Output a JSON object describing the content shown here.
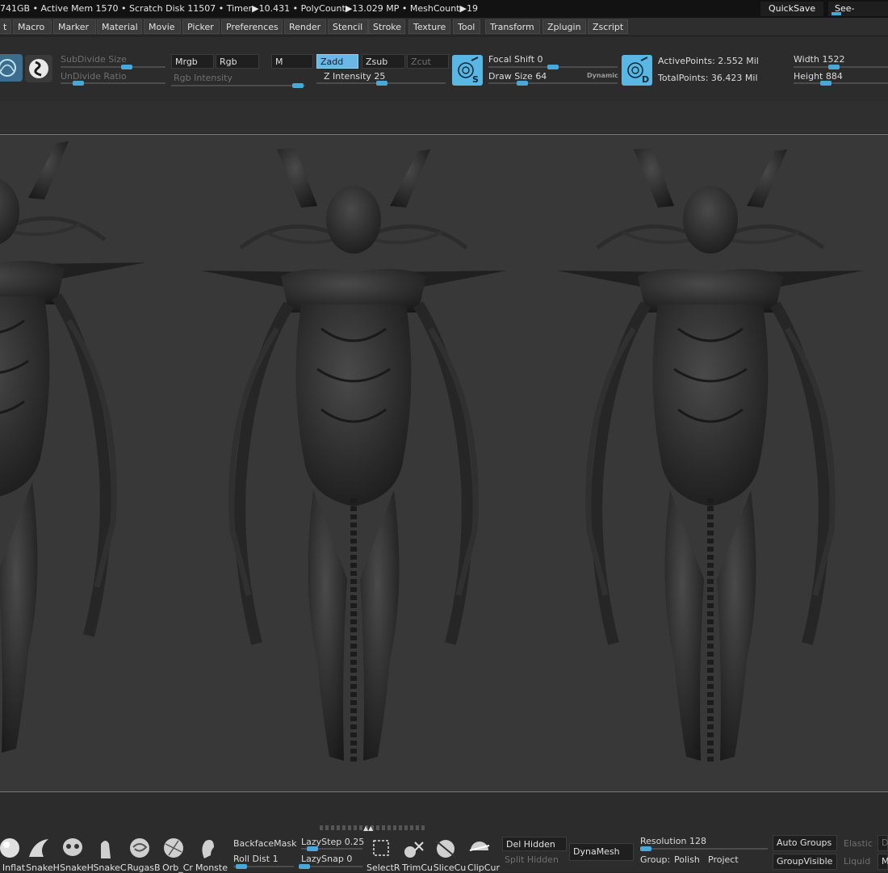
{
  "status": {
    "text": "741GB • Active Mem 1570 • Scratch Disk 11507 • Timer▶10.431 • PolyCount▶13.029 MP • MeshCount▶19",
    "quicksave": "QuickSave",
    "seethrough": "See-through"
  },
  "menu": [
    "t",
    "Macro",
    "Marker",
    "Material",
    "Movie",
    "Picker",
    "Preferences",
    "Render",
    "Stencil",
    "Stroke",
    "Texture",
    "Tool",
    "Transform",
    "Zplugin",
    "Zscript"
  ],
  "shelf": {
    "subdivide_size": "SubDivide Size",
    "undivide_ratio": "UnDivide Ratio",
    "mrgb": "Mrgb",
    "rgb": "Rgb",
    "m": "M",
    "rgb_intensity": "Rgb Intensity",
    "zadd": "Zadd",
    "zsub": "Zsub",
    "zcut": "Zcut",
    "z_intensity": "Z Intensity",
    "z_intensity_value": "25",
    "focal_shift": "Focal Shift",
    "focal_shift_value": "0",
    "draw_size": "Draw Size",
    "draw_size_value": "64",
    "dynamic": "Dynamic",
    "icon_s": "S",
    "icon_d": "D",
    "active_points": "ActivePoints: 2.552 Mil",
    "total_points": "TotalPoints: 36.423 Mil",
    "width_label": "Width",
    "width_value": "1522",
    "height_label": "Height",
    "height_value": "884"
  },
  "bottom": {
    "brushes": [
      "Inflat",
      "SnakeH",
      "SnakeH",
      "SnakeC",
      "RugasB",
      "Orb_Cr",
      "Monste"
    ],
    "backface_mask": "BackfaceMask",
    "roll_dist": "Roll Dist",
    "roll_dist_value": "1",
    "lazystep": "LazyStep",
    "lazystep_value": "0.25",
    "lazysnap": "LazySnap",
    "lazysnap_value": "0",
    "tools": [
      "SelectRe",
      "TrimCu",
      "SliceCu",
      "ClipCur"
    ],
    "del_hidden": "Del Hidden",
    "split_hidden": "Split Hidden",
    "dynamesh": "DynaMesh",
    "resolution": "Resolution",
    "resolution_value": "128",
    "group": "Group:",
    "polish": "Polish",
    "project": "Project",
    "auto_groups": "Auto Groups",
    "group_visible": "GroupVisible",
    "elastic": "Elastic",
    "liquid": "Liquid",
    "d": "D",
    "m": "M"
  },
  "colors": {
    "accent": "#5ab7e3",
    "canvas": "#383838",
    "ui": "#2c2c2c"
  }
}
